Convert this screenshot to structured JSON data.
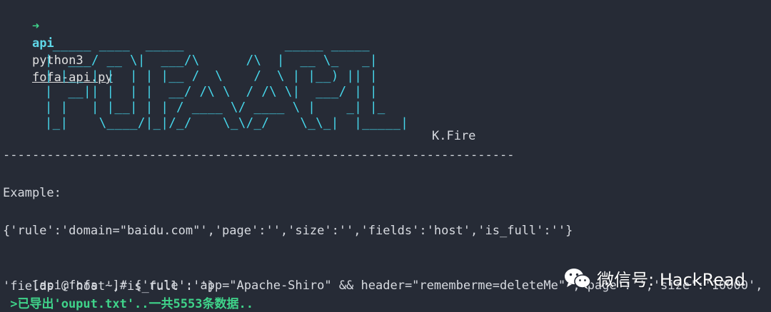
{
  "terminal": {
    "prompt_arrow": "➜",
    "prompt_dir": "api",
    "command": "python3",
    "command_arg": "fofa-api.py",
    "banner_lines": [
      "  _____ ____  _____             _____ _____",
      " |  ___/ __ \\|  ___/\\      /\\  |  __ \\_   _|",
      " | |__ | |  | | |__ /  \\    /  \\ | |__) || |",
      " |  __|| |  | |  __/ /\\ \\  / /\\ \\|  ___/ | |",
      " | |   | |__| | | / ____ \\/ ____ \\ |    _| |_",
      " |_|    \\____/|_|/_/    \\_\\/_/    \\_\\_|  |_____|"
    ],
    "author": "K.Fire",
    "divider": "----------------------------------------------------------------------",
    "example_label": "Example:",
    "example_line": "{'rule':'domain=\"baidu.com\"','page':'','size':'','fields':'host','is_full':''}",
    "input_prompt": "[api@fofa ~]# ",
    "input_line_1": "{'rule':'app=\"Apache-Shiro\" && header=\"rememberme=deleteMe\"','page':'','size':'10000',",
    "input_line_2": "'fields':'host','is_full':''}",
    "output_line": " >已导出'ouput.txt'..一共5553条数据.."
  },
  "watermark": {
    "icon": "wechat-icon",
    "text": "微信号: HackRead"
  },
  "colors": {
    "background": "#262b36",
    "accent_cyan": "#46d6ea",
    "accent_green": "#3fd38a"
  }
}
